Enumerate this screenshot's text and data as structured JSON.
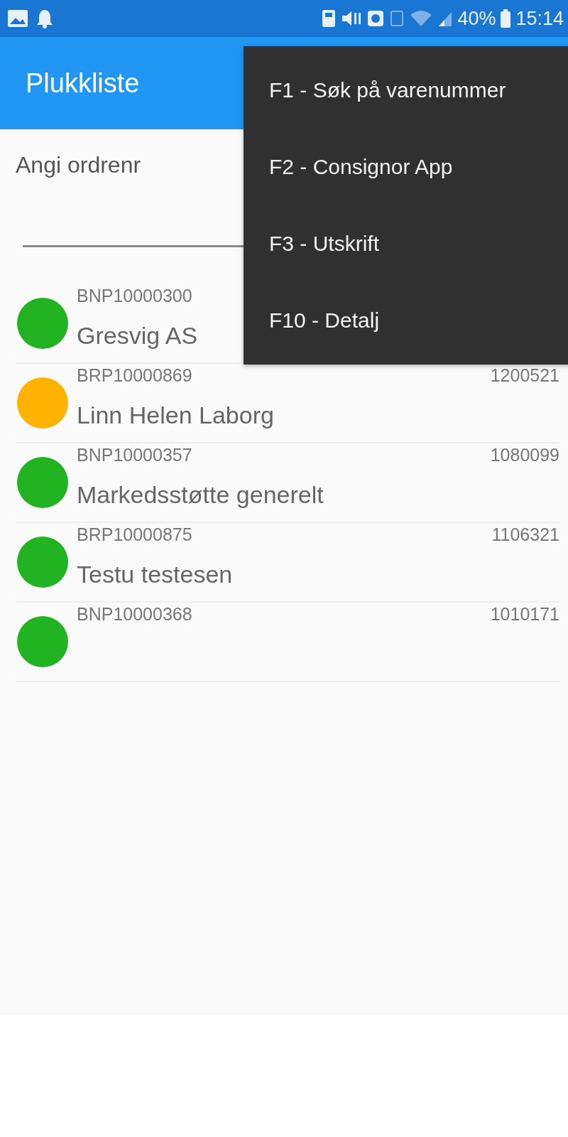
{
  "status_bar": {
    "battery": "40%",
    "time": "15:14"
  },
  "app_bar": {
    "title": "Plukkliste"
  },
  "order_field": {
    "label": "Angi ordrenr"
  },
  "orders": [
    {
      "code": "BNP10000300",
      "customer": "Gresvig AS",
      "color": "#22b322"
    },
    {
      "code": "BRP10000869",
      "number": "1200521",
      "customer": "Linn Helen Laborg",
      "color": "#ffb300"
    },
    {
      "code": "BNP10000357",
      "number": "1080099",
      "customer": "Markedsstøtte generelt",
      "color": "#22b322"
    },
    {
      "code": "BRP10000875",
      "number": "1106321",
      "customer": "Testu testesen",
      "color": "#22b322"
    },
    {
      "code": "BNP10000368",
      "number": "1010171",
      "color": "#22b322"
    }
  ],
  "menu": [
    {
      "label": "F1 - Søk på varenummer"
    },
    {
      "label": "F2 - Consignor App"
    },
    {
      "label": "F3 - Utskrift"
    },
    {
      "label": "F10 - Detalj"
    }
  ]
}
